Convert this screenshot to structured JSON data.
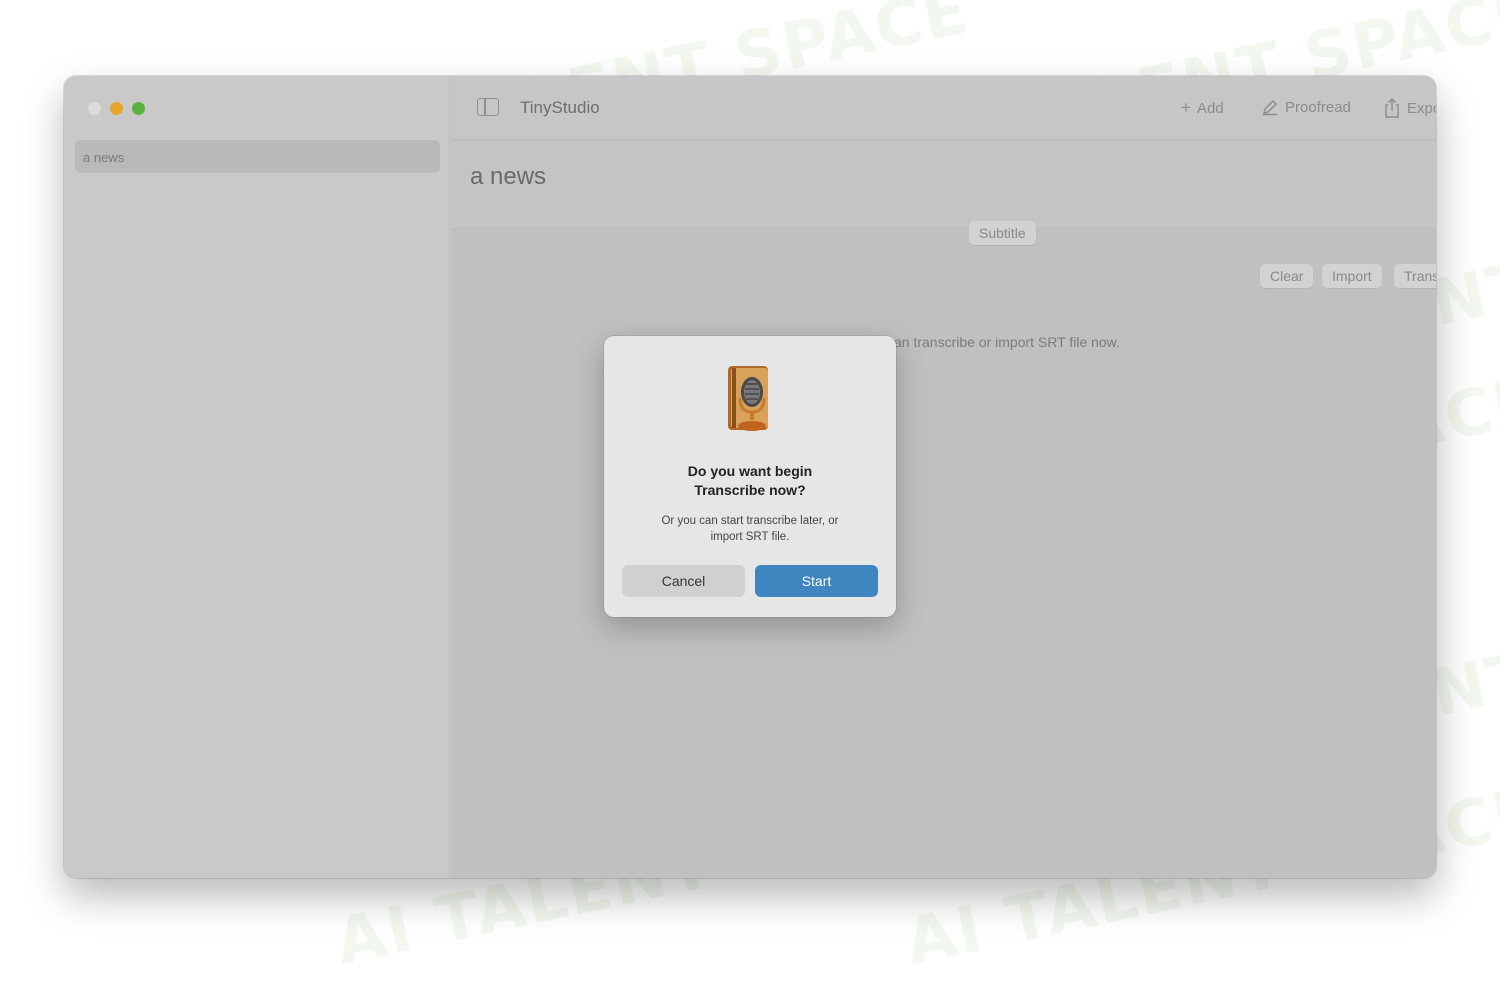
{
  "window": {
    "app_title": "TinyStudio",
    "toolbar": {
      "add_label": "Add",
      "proofread_label": "Proofread",
      "export_label": "Export"
    }
  },
  "sidebar": {
    "items": [
      {
        "label": "a news"
      }
    ]
  },
  "document": {
    "title": "a news",
    "segment_label": "Subtitle",
    "actions": {
      "clear_label": "Clear",
      "import_label": "Import",
      "transcribe_label": "Transcribe"
    },
    "hint_text": "can transcribe or import SRT file now."
  },
  "dialog": {
    "title_line1": "Do you want begin",
    "title_line2": "Transcribe now?",
    "message_line1": "Or you can start transcribe later, or",
    "message_line2": "import SRT file.",
    "cancel_label": "Cancel",
    "start_label": "Start"
  },
  "colors": {
    "accent": "#3f86c0",
    "traffic_close": "#dcdcdc",
    "traffic_min": "#e6a62a",
    "traffic_max": "#58b33d"
  },
  "icons": {
    "sidebar_toggle": "sidebar-toggle-icon",
    "add": "plus-icon",
    "proofread": "pencil-icon",
    "export": "share-icon",
    "export_menu": "chevron-down-icon",
    "dialog": "microphone-app-icon"
  }
}
